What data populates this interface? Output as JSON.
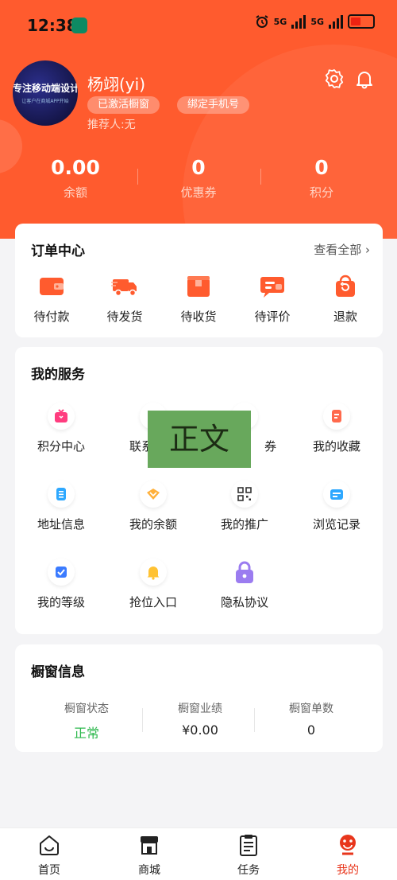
{
  "status_bar": {
    "time": "12:38",
    "network1": "5G",
    "network2": "5G",
    "battery_level": 0.35
  },
  "profile": {
    "avatar_line1": "专注移动端设计",
    "avatar_line2": "让客户在商城APP开始",
    "name": "杨翊(yi)",
    "badge_activated": "已激活橱窗",
    "badge_bind_phone": "绑定手机号",
    "referrer": "推荐人:无"
  },
  "stats": [
    {
      "value": "0.00",
      "label": "余额"
    },
    {
      "value": "0",
      "label": "优惠券"
    },
    {
      "value": "0",
      "label": "积分"
    }
  ],
  "orders": {
    "title": "订单中心",
    "view_all": "查看全部",
    "items": [
      {
        "label": "待付款",
        "icon": "wallet-icon"
      },
      {
        "label": "待发货",
        "icon": "truck-icon"
      },
      {
        "label": "待收货",
        "icon": "package-icon"
      },
      {
        "label": "待评价",
        "icon": "comment-icon"
      },
      {
        "label": "退款",
        "icon": "refund-bag-icon"
      }
    ]
  },
  "services": {
    "title": "我的服务",
    "items": [
      {
        "label": "积分中心",
        "icon": "gift-icon"
      },
      {
        "label": "联系",
        "icon": "contact-icon"
      },
      {
        "label": "券",
        "icon": "coupon-icon"
      },
      {
        "label": "我的收藏",
        "icon": "favorites-icon"
      },
      {
        "label": "地址信息",
        "icon": "address-icon"
      },
      {
        "label": "我的余额",
        "icon": "balance-icon"
      },
      {
        "label": "我的推广",
        "icon": "qrcode-icon"
      },
      {
        "label": "浏览记录",
        "icon": "history-icon"
      },
      {
        "label": "我的等级",
        "icon": "level-icon"
      },
      {
        "label": "抢位入口",
        "icon": "bell-icon"
      },
      {
        "label": "隐私协议",
        "icon": "lock-icon"
      }
    ],
    "overlay_text": "正文"
  },
  "showcase": {
    "title": "橱窗信息",
    "items": [
      {
        "label": "橱窗状态",
        "value": "正常"
      },
      {
        "label": "橱窗业绩",
        "value": "¥0.00"
      },
      {
        "label": "橱窗单数",
        "value": "0"
      }
    ]
  },
  "tabs": [
    {
      "label": "首页",
      "icon": "home-icon"
    },
    {
      "label": "商城",
      "icon": "store-icon"
    },
    {
      "label": "任务",
      "icon": "clipboard-icon"
    },
    {
      "label": "我的",
      "icon": "profile-icon"
    }
  ],
  "colors": {
    "brand": "#ff5b2e",
    "status_green": "#2db84d",
    "active_tab": "#e8361c"
  }
}
